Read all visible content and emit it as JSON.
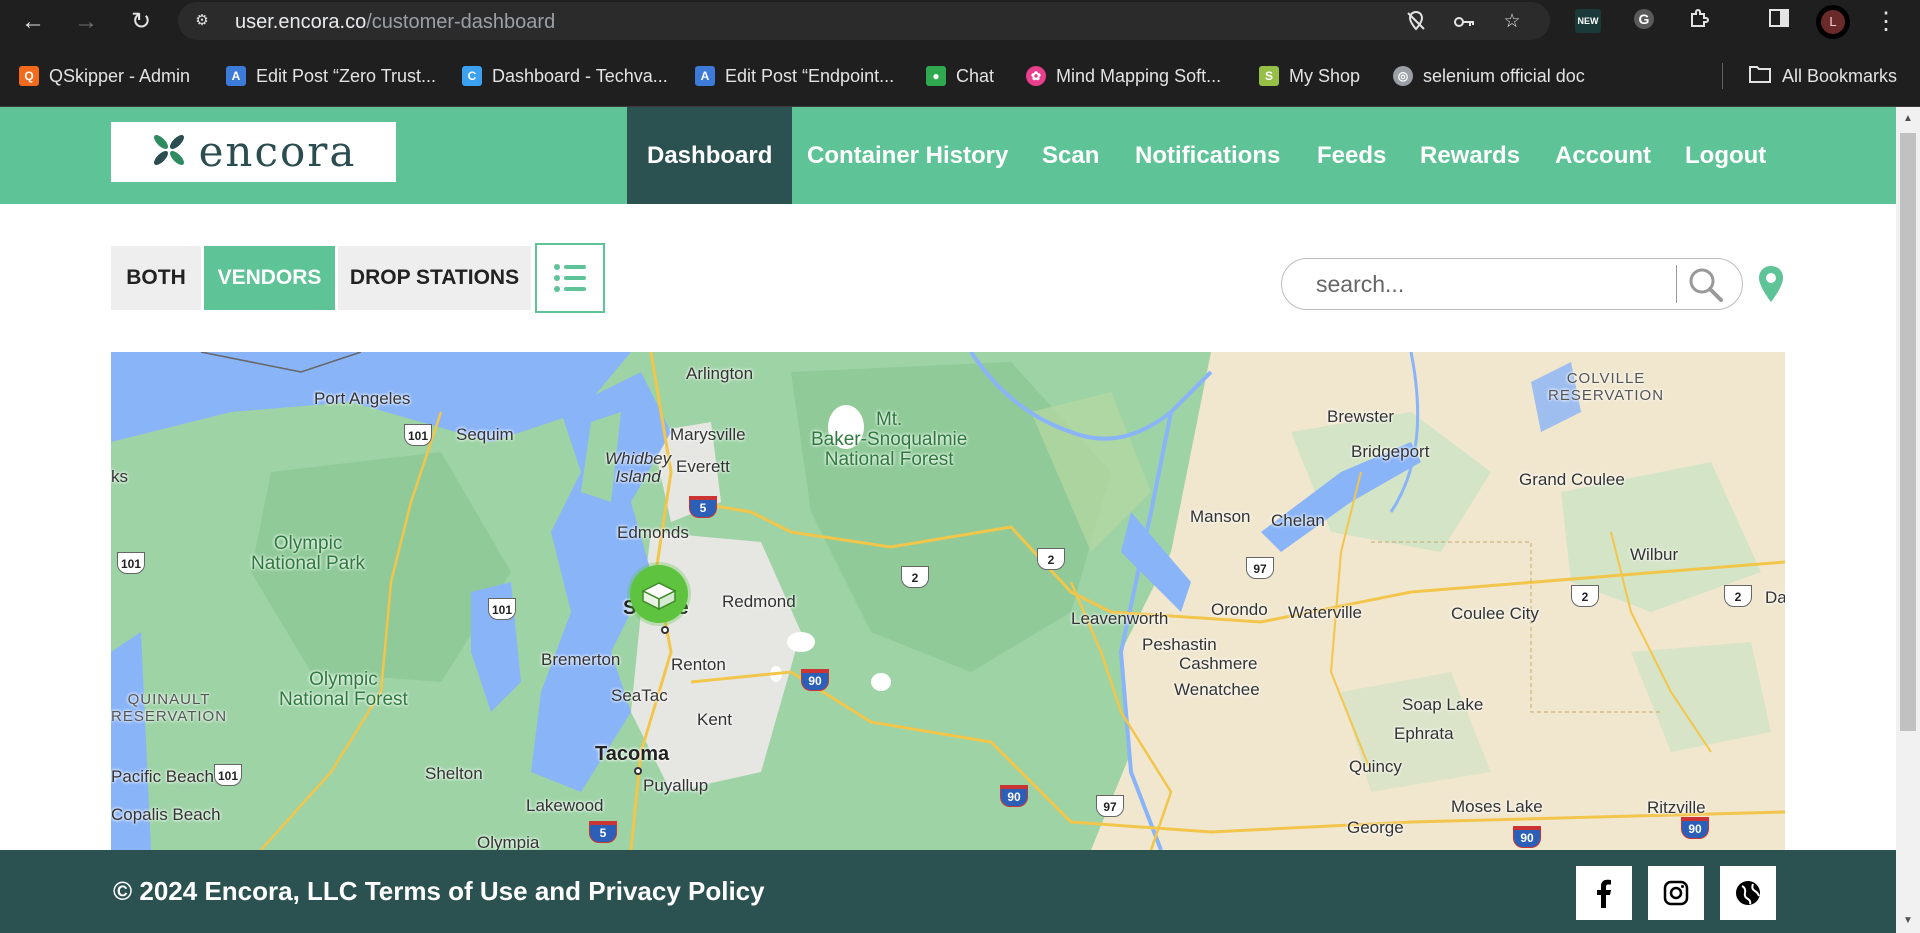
{
  "browser": {
    "url_host": "user.encora.co",
    "url_path": "/customer-dashboard",
    "profile_initial": "L",
    "new_badge": "NEW",
    "bookmarks": [
      {
        "label": "QSkipper - Admin",
        "icon": "qskipper-icon",
        "color": "#f26b1d"
      },
      {
        "label": "Edit Post “Zero Trust...",
        "icon": "wordpress-a-icon",
        "color": "#3d7bd9"
      },
      {
        "label": "Dashboard - Techva...",
        "icon": "c-logo-icon",
        "color": "#3ba1f0"
      },
      {
        "label": "Edit Post “Endpoint...",
        "icon": "wordpress-a-icon",
        "color": "#3d7bd9"
      },
      {
        "label": "Chat",
        "icon": "chat-icon",
        "color": "#2fa84f"
      },
      {
        "label": "Mind Mapping Soft...",
        "icon": "mindmap-icon",
        "color": "#e83e8c"
      },
      {
        "label": "My Shop",
        "icon": "shop-bag-icon",
        "color": "#95bf47"
      },
      {
        "label": "selenium official doc",
        "icon": "globe-icon",
        "color": "#9aa0a6"
      }
    ],
    "all_bookmarks": "All Bookmarks"
  },
  "header": {
    "logo_text": "encora",
    "nav": [
      {
        "label": "Dashboard",
        "active": true
      },
      {
        "label": "Container History",
        "active": false
      },
      {
        "label": "Scan",
        "active": false
      },
      {
        "label": "Notifications",
        "active": false
      },
      {
        "label": "Feeds",
        "active": false
      },
      {
        "label": "Rewards",
        "active": false
      },
      {
        "label": "Account",
        "active": false
      },
      {
        "label": "Logout",
        "active": false
      }
    ]
  },
  "filters": {
    "both": "BOTH",
    "vendors": "VENDORS",
    "drop_stations": "DROP STATIONS",
    "active": "VENDORS"
  },
  "search": {
    "placeholder": "search..."
  },
  "map": {
    "labels": {
      "port_angeles": "Port Angeles",
      "sequim": "Sequim",
      "arlington": "Arlington",
      "marysville": "Marysville",
      "whidbey_island": "Whidbey\nIsland",
      "everett": "Everett",
      "mt_baker": "Mt.\nBaker-Snoqualmie\nNational Forest",
      "colville": "COLVILLE\nRESERVATION",
      "brewster": "Brewster",
      "bridgeport": "Bridgeport",
      "grand_coulee": "Grand Coulee",
      "olympic_np": "Olympic\nNational Park",
      "edmonds": "Edmonds",
      "manson": "Manson",
      "chelan": "Chelan",
      "wilbur": "Wilbur",
      "seattle": "Seattle",
      "redmond": "Redmond",
      "leavenworth": "Leavenworth",
      "orondo": "Orondo",
      "waterville": "Waterville",
      "coulee_city": "Coulee City",
      "da": "Da",
      "bremerton": "Bremerton",
      "renton": "Renton",
      "peshastin": "Peshastin",
      "cashmere": "Cashmere",
      "olympic_nf": "Olympic\nNational Forest",
      "wenatchee": "Wenatchee",
      "quinault": "QUINAULT\nRESERVATION",
      "seatac": "SeaTac",
      "kent": "Kent",
      "soap_lake": "Soap Lake",
      "ephrata": "Ephrata",
      "tacoma": "Tacoma",
      "pacific_beach": "Pacific Beach",
      "shelton": "Shelton",
      "puyallup": "Puyallup",
      "quincy": "Quincy",
      "lakewood": "Lakewood",
      "moses_lake": "Moses Lake",
      "ritzville": "Ritzville",
      "copalis_beach": "Copalis Beach",
      "george": "George",
      "olympia": "Olympia",
      "ks": "ks"
    },
    "shields": {
      "us101": "101",
      "i5": "5",
      "us2": "2",
      "i90": "90",
      "us97": "97"
    }
  },
  "footer": {
    "text": "© 2024 Encora, LLC Terms of Use and Privacy Policy"
  }
}
